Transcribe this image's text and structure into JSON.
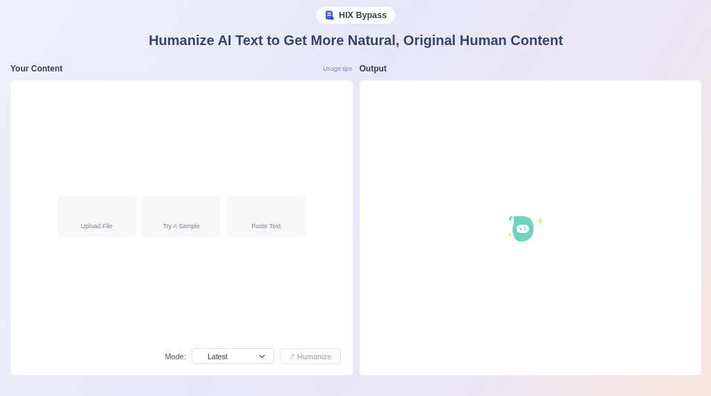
{
  "brand": {
    "name": "HIX Bypass"
  },
  "title": "Humanize AI Text to Get More Natural, Original Human Content",
  "input_panel": {
    "label": "Your Content",
    "usage_tips": "Usage tips",
    "actions": [
      {
        "label": "Upload File"
      },
      {
        "label": "Try A Sample"
      },
      {
        "label": "Paste Text"
      }
    ],
    "mode_label": "Mode:",
    "mode": {
      "value": "Latest"
    },
    "humanize_button": {
      "label": "Humanize",
      "disabled": true
    }
  },
  "output_panel": {
    "label": "Output"
  }
}
